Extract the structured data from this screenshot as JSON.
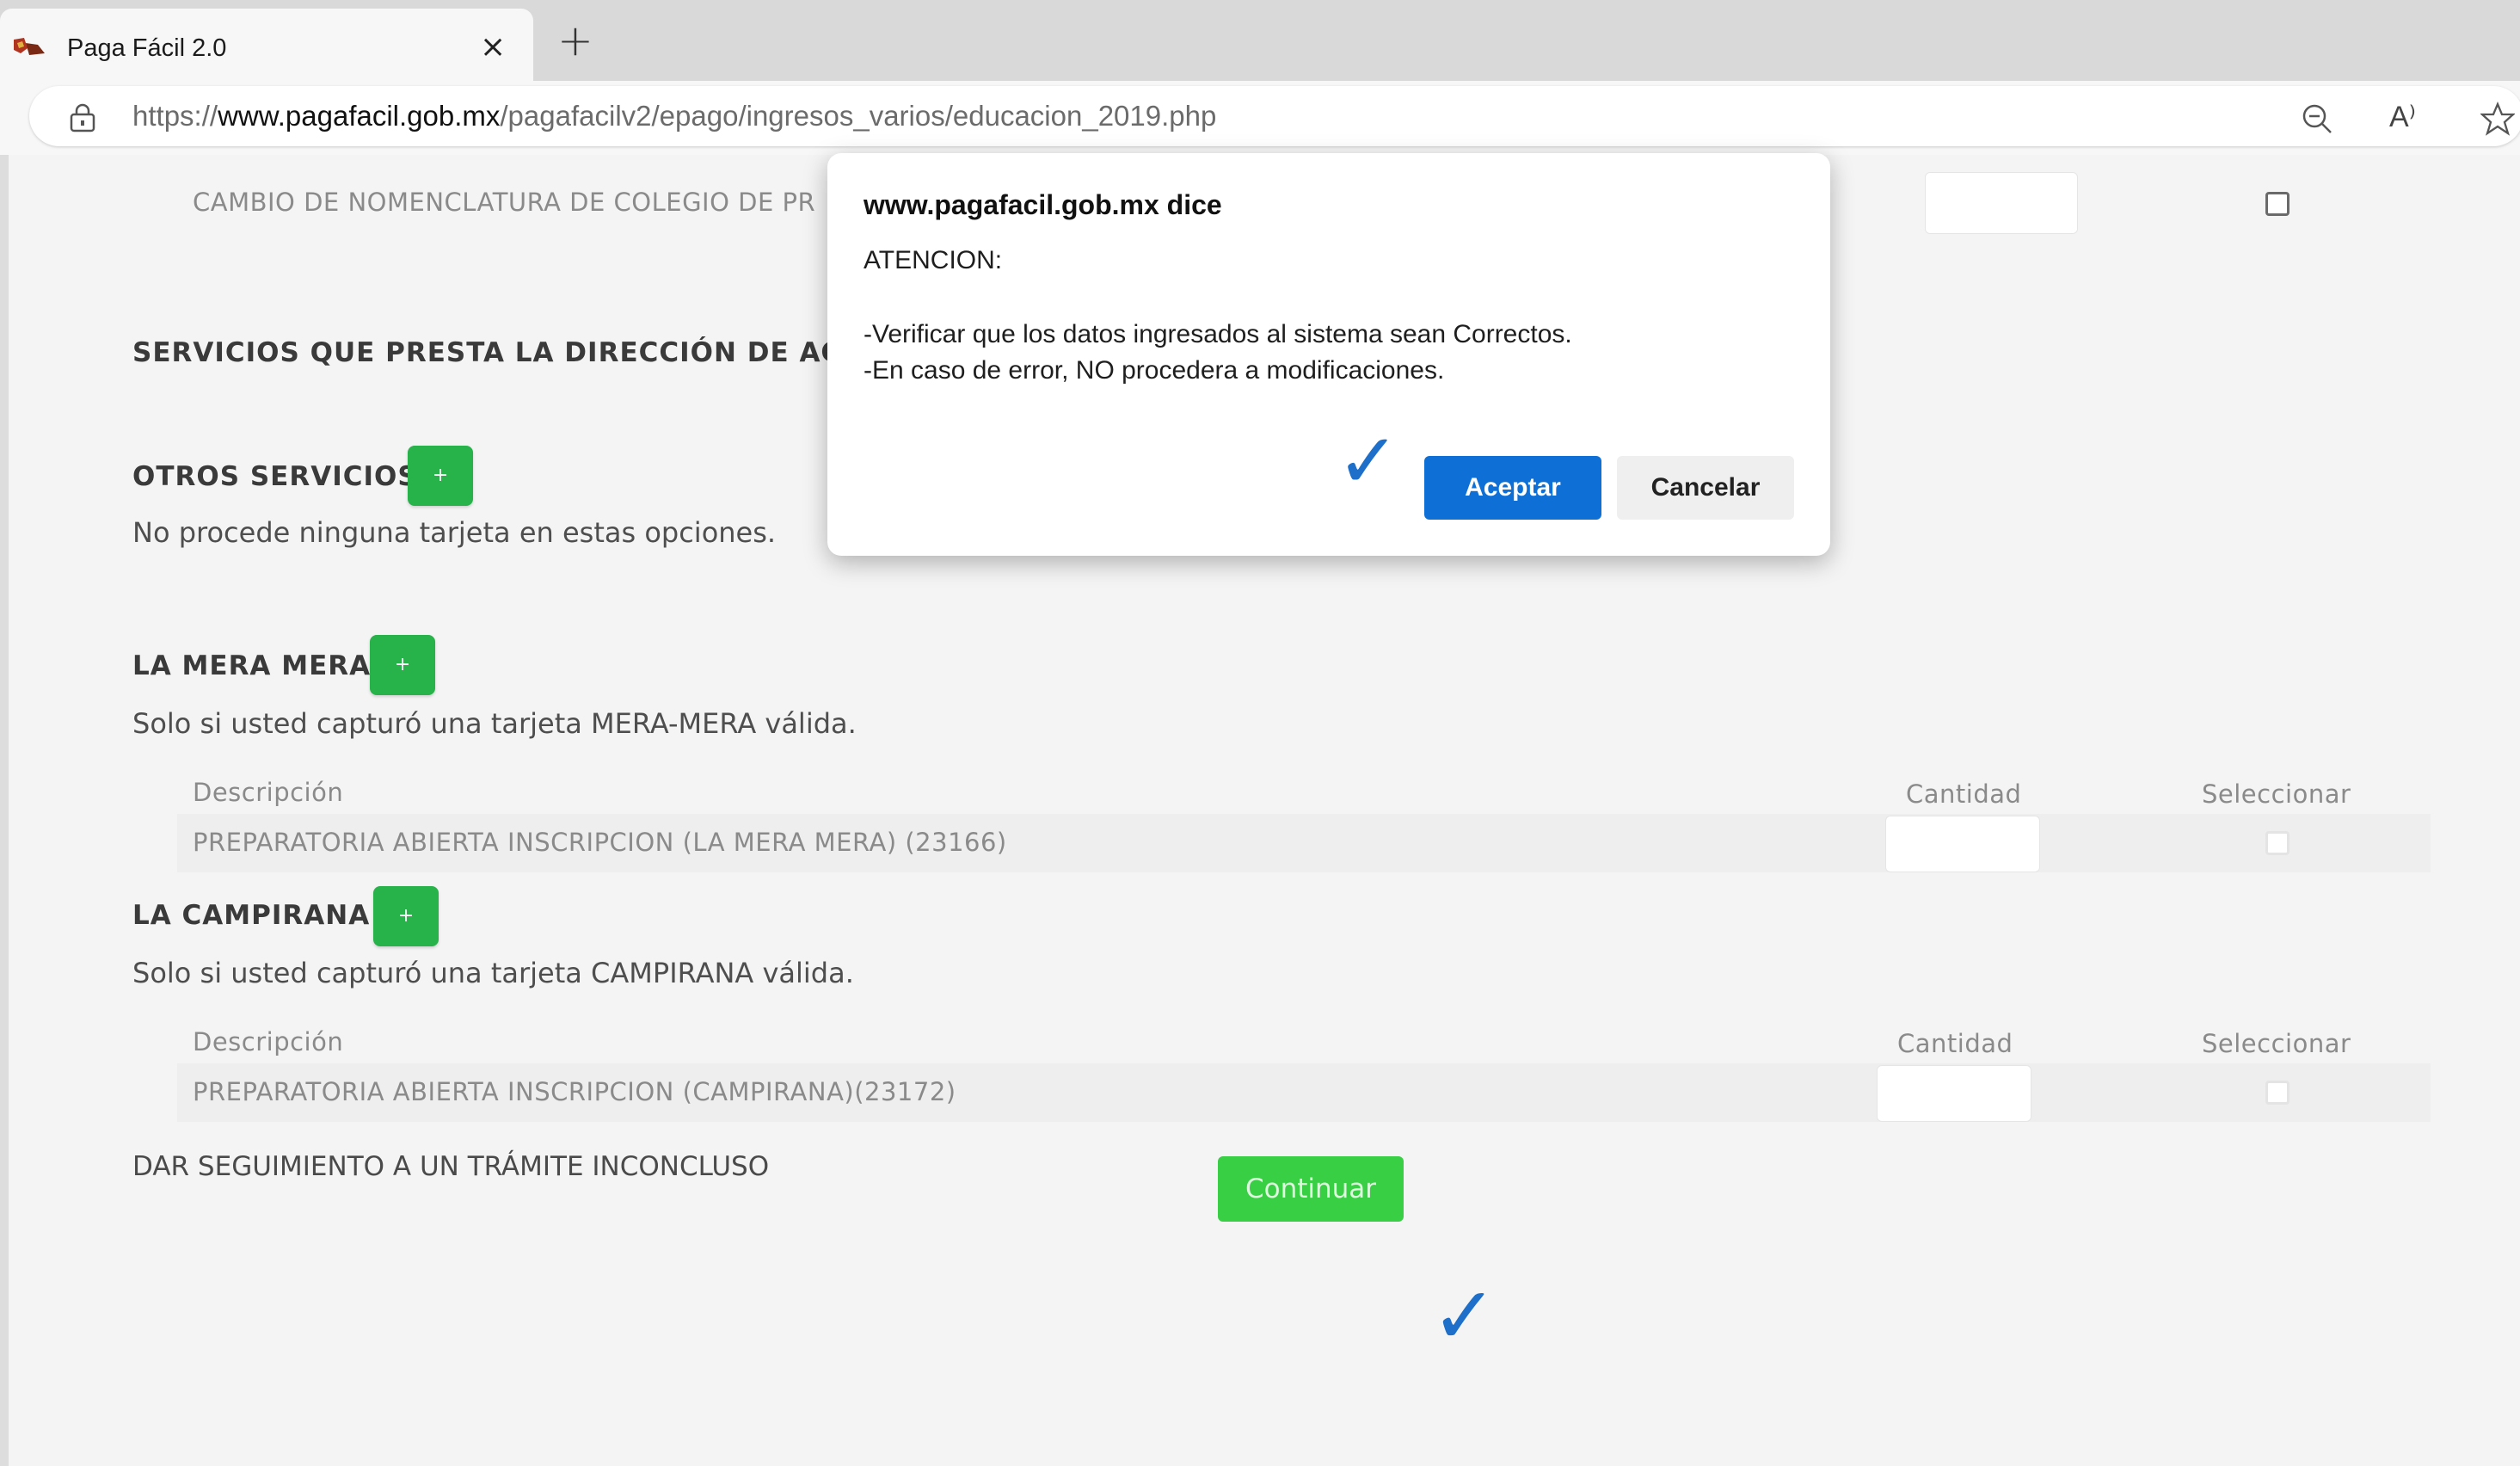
{
  "browser": {
    "tab_title": "Paga Fácil 2.0",
    "tab_close": "×",
    "new_tab": "+",
    "url_scheme": "https://",
    "url_host": "www.pagafacil.gob.mx",
    "url_path": "/pagafacilv2/epago/ingresos_varios/educacion_2019.php",
    "read_aloud": "A⁾"
  },
  "page": {
    "row_cambio": "CAMBIO DE NOMENCLATURA DE COLEGIO DE PR",
    "servicios_title": "SERVICIOS QUE PRESTA LA DIRECCIÓN DE ACREDI",
    "otros": {
      "title": "OTROS SERVICIOS",
      "plus": "+",
      "note": "No procede ninguna tarjeta en estas opciones."
    },
    "mera_mera": {
      "title": "LA MERA MERA",
      "plus": "+",
      "note": "Solo si usted capturó una tarjeta MERA-MERA válida.",
      "col_descripcion": "Descripción",
      "col_cantidad": "Cantidad",
      "col_seleccionar": "Seleccionar",
      "item": "PREPARATORIA ABIERTA INSCRIPCION (LA MERA MERA) (23166)"
    },
    "campirana": {
      "title": "LA CAMPIRANA",
      "plus": "+",
      "note": "Solo si usted capturó una tarjeta CAMPIRANA válida.",
      "col_descripcion": "Descripción",
      "col_cantidad": "Cantidad",
      "col_seleccionar": "Seleccionar",
      "item": "PREPARATORIA ABIERTA INSCRIPCION (CAMPIRANA)(23172)"
    },
    "seguimiento": "DAR SEGUIMIENTO A UN TRÁMITE INCONCLUSO",
    "continuar": "Continuar",
    "checkmark": "✓"
  },
  "dialog": {
    "title": "www.pagafacil.gob.mx dice",
    "line1": "ATENCION:",
    "line2": "-Verificar que los datos ingresados al sistema sean Correctos.",
    "line3": "-En caso de error, NO procedera a modificaciones.",
    "ok": "Aceptar",
    "cancel": "Cancelar",
    "checkmark": "✓"
  },
  "colors": {
    "green_button": "#27b24a",
    "continuar": "#38cf45",
    "ok_button": "#0e70d6",
    "checkmark": "#1d6fc9"
  }
}
